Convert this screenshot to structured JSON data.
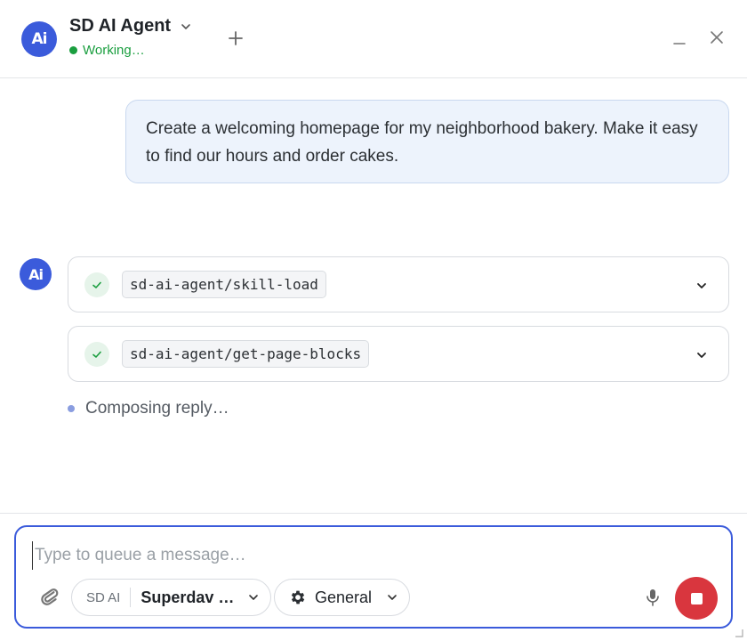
{
  "header": {
    "avatar_label": "Ai",
    "title": "SD AI Agent",
    "status": "Working…",
    "status_color": "#1a9e3f"
  },
  "conversation": {
    "user_message": "Create a welcoming homepage for my neighborhood bakery. Make it easy to find our hours and order cakes.",
    "agent_avatar_label": "Ai",
    "tool_calls": [
      {
        "name": "sd-ai-agent/skill-load",
        "status": "done"
      },
      {
        "name": "sd-ai-agent/get-page-blocks",
        "status": "done"
      }
    ],
    "composing_text": "Composing reply…"
  },
  "composer": {
    "placeholder": "Type to queue a message…",
    "value": "",
    "model_prefix": "SD AI",
    "model_name": "Superdav …",
    "mode": "General"
  },
  "icons": {
    "new": "plus-icon",
    "minimize": "minimize-icon",
    "close": "close-icon",
    "tool_status": "check-icon",
    "expand": "chevron-down-icon",
    "attach": "paperclip-icon",
    "mode": "gear-icon",
    "mic": "microphone-icon",
    "stop": "stop-icon"
  },
  "colors": {
    "accent": "#3b5bdb",
    "stop": "#d9363e",
    "user_bubble": "#edf3fc"
  }
}
